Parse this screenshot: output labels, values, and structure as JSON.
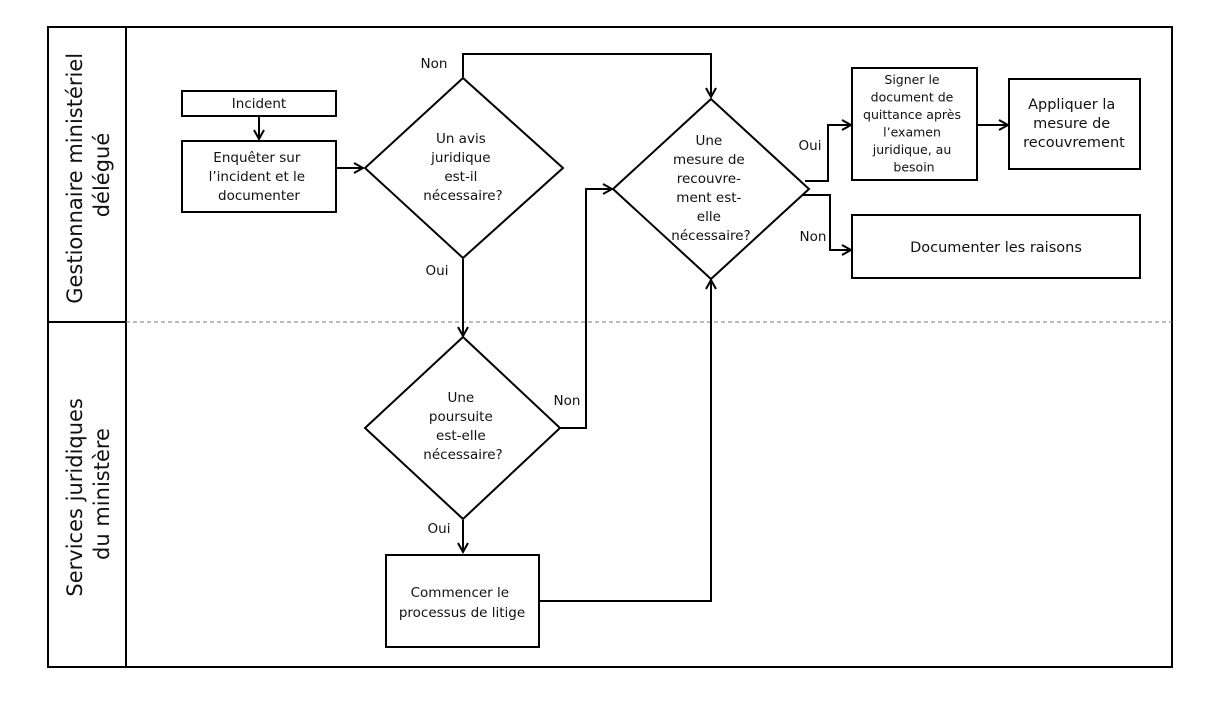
{
  "lanes": [
    {
      "id": "lane-gestionnaire",
      "label_lines": [
        "Gestionnaire ministériel",
        "délégué"
      ]
    },
    {
      "id": "lane-services-juridiques",
      "label_lines": [
        "Services juridiques",
        "du ministère"
      ]
    }
  ],
  "nodes": {
    "incident": {
      "type": "process",
      "lines": [
        "Incident"
      ]
    },
    "enqueter": {
      "type": "process",
      "lines": [
        "Enquêter sur",
        "l’incident et le",
        "documenter"
      ]
    },
    "avis_juridique": {
      "type": "decision",
      "lines": [
        "Un avis",
        "juridique",
        "est-il",
        "nécessaire?"
      ]
    },
    "mesure_recouvrement": {
      "type": "decision",
      "lines": [
        "Une",
        "mesure de",
        "recouvre-",
        "ment est-",
        "elle",
        "nécessaire?"
      ]
    },
    "signer": {
      "type": "process",
      "lines": [
        "Signer le",
        "document de",
        "quittance après",
        "l’examen",
        "juridique, au",
        "besoin"
      ]
    },
    "appliquer": {
      "type": "process",
      "lines": [
        "Appliquer la",
        "mesure de",
        "recouvrement"
      ]
    },
    "documenter_raisons": {
      "type": "process",
      "lines": [
        "Documenter les raisons"
      ]
    },
    "poursuite": {
      "type": "decision",
      "lines": [
        "Une",
        "poursuite",
        "est-elle",
        "nécessaire?"
      ]
    },
    "litige": {
      "type": "process",
      "lines": [
        "Commencer le",
        "processus de litige"
      ]
    }
  },
  "edges": [
    {
      "from": "incident",
      "to": "enqueter",
      "label": ""
    },
    {
      "from": "enqueter",
      "to": "avis_juridique",
      "label": ""
    },
    {
      "from": "avis_juridique",
      "to": "mesure_recouvrement",
      "label": "Non"
    },
    {
      "from": "avis_juridique",
      "to": "poursuite",
      "label": "Oui"
    },
    {
      "from": "mesure_recouvrement",
      "to": "signer",
      "label": "Oui"
    },
    {
      "from": "mesure_recouvrement",
      "to": "documenter_raisons",
      "label": "Non"
    },
    {
      "from": "signer",
      "to": "appliquer",
      "label": ""
    },
    {
      "from": "poursuite",
      "to": "mesure_recouvrement",
      "label": "Non"
    },
    {
      "from": "poursuite",
      "to": "litige",
      "label": "Oui"
    },
    {
      "from": "litige",
      "to": "mesure_recouvrement",
      "label": ""
    }
  ]
}
